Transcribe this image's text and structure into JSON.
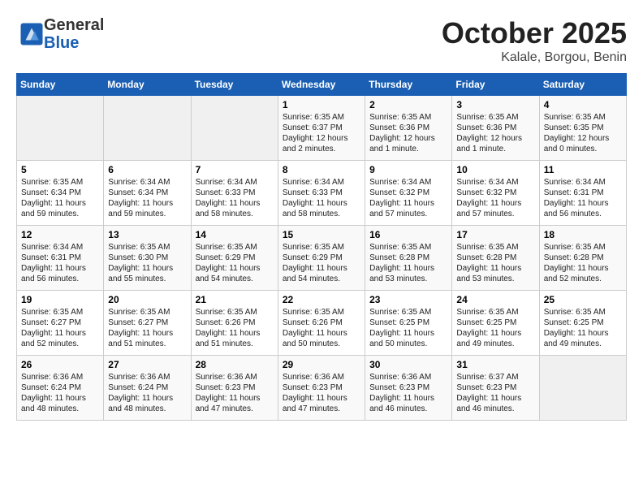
{
  "header": {
    "logo_general": "General",
    "logo_blue": "Blue",
    "month": "October 2025",
    "location": "Kalale, Borgou, Benin"
  },
  "weekdays": [
    "Sunday",
    "Monday",
    "Tuesday",
    "Wednesday",
    "Thursday",
    "Friday",
    "Saturday"
  ],
  "weeks": [
    [
      {
        "day": "",
        "info": ""
      },
      {
        "day": "",
        "info": ""
      },
      {
        "day": "",
        "info": ""
      },
      {
        "day": "1",
        "info": "Sunrise: 6:35 AM\nSunset: 6:37 PM\nDaylight: 12 hours\nand 2 minutes."
      },
      {
        "day": "2",
        "info": "Sunrise: 6:35 AM\nSunset: 6:36 PM\nDaylight: 12 hours\nand 1 minute."
      },
      {
        "day": "3",
        "info": "Sunrise: 6:35 AM\nSunset: 6:36 PM\nDaylight: 12 hours\nand 1 minute."
      },
      {
        "day": "4",
        "info": "Sunrise: 6:35 AM\nSunset: 6:35 PM\nDaylight: 12 hours\nand 0 minutes."
      }
    ],
    [
      {
        "day": "5",
        "info": "Sunrise: 6:35 AM\nSunset: 6:34 PM\nDaylight: 11 hours\nand 59 minutes."
      },
      {
        "day": "6",
        "info": "Sunrise: 6:34 AM\nSunset: 6:34 PM\nDaylight: 11 hours\nand 59 minutes."
      },
      {
        "day": "7",
        "info": "Sunrise: 6:34 AM\nSunset: 6:33 PM\nDaylight: 11 hours\nand 58 minutes."
      },
      {
        "day": "8",
        "info": "Sunrise: 6:34 AM\nSunset: 6:33 PM\nDaylight: 11 hours\nand 58 minutes."
      },
      {
        "day": "9",
        "info": "Sunrise: 6:34 AM\nSunset: 6:32 PM\nDaylight: 11 hours\nand 57 minutes."
      },
      {
        "day": "10",
        "info": "Sunrise: 6:34 AM\nSunset: 6:32 PM\nDaylight: 11 hours\nand 57 minutes."
      },
      {
        "day": "11",
        "info": "Sunrise: 6:34 AM\nSunset: 6:31 PM\nDaylight: 11 hours\nand 56 minutes."
      }
    ],
    [
      {
        "day": "12",
        "info": "Sunrise: 6:34 AM\nSunset: 6:31 PM\nDaylight: 11 hours\nand 56 minutes."
      },
      {
        "day": "13",
        "info": "Sunrise: 6:35 AM\nSunset: 6:30 PM\nDaylight: 11 hours\nand 55 minutes."
      },
      {
        "day": "14",
        "info": "Sunrise: 6:35 AM\nSunset: 6:29 PM\nDaylight: 11 hours\nand 54 minutes."
      },
      {
        "day": "15",
        "info": "Sunrise: 6:35 AM\nSunset: 6:29 PM\nDaylight: 11 hours\nand 54 minutes."
      },
      {
        "day": "16",
        "info": "Sunrise: 6:35 AM\nSunset: 6:28 PM\nDaylight: 11 hours\nand 53 minutes."
      },
      {
        "day": "17",
        "info": "Sunrise: 6:35 AM\nSunset: 6:28 PM\nDaylight: 11 hours\nand 53 minutes."
      },
      {
        "day": "18",
        "info": "Sunrise: 6:35 AM\nSunset: 6:28 PM\nDaylight: 11 hours\nand 52 minutes."
      }
    ],
    [
      {
        "day": "19",
        "info": "Sunrise: 6:35 AM\nSunset: 6:27 PM\nDaylight: 11 hours\nand 52 minutes."
      },
      {
        "day": "20",
        "info": "Sunrise: 6:35 AM\nSunset: 6:27 PM\nDaylight: 11 hours\nand 51 minutes."
      },
      {
        "day": "21",
        "info": "Sunrise: 6:35 AM\nSunset: 6:26 PM\nDaylight: 11 hours\nand 51 minutes."
      },
      {
        "day": "22",
        "info": "Sunrise: 6:35 AM\nSunset: 6:26 PM\nDaylight: 11 hours\nand 50 minutes."
      },
      {
        "day": "23",
        "info": "Sunrise: 6:35 AM\nSunset: 6:25 PM\nDaylight: 11 hours\nand 50 minutes."
      },
      {
        "day": "24",
        "info": "Sunrise: 6:35 AM\nSunset: 6:25 PM\nDaylight: 11 hours\nand 49 minutes."
      },
      {
        "day": "25",
        "info": "Sunrise: 6:35 AM\nSunset: 6:25 PM\nDaylight: 11 hours\nand 49 minutes."
      }
    ],
    [
      {
        "day": "26",
        "info": "Sunrise: 6:36 AM\nSunset: 6:24 PM\nDaylight: 11 hours\nand 48 minutes."
      },
      {
        "day": "27",
        "info": "Sunrise: 6:36 AM\nSunset: 6:24 PM\nDaylight: 11 hours\nand 48 minutes."
      },
      {
        "day": "28",
        "info": "Sunrise: 6:36 AM\nSunset: 6:23 PM\nDaylight: 11 hours\nand 47 minutes."
      },
      {
        "day": "29",
        "info": "Sunrise: 6:36 AM\nSunset: 6:23 PM\nDaylight: 11 hours\nand 47 minutes."
      },
      {
        "day": "30",
        "info": "Sunrise: 6:36 AM\nSunset: 6:23 PM\nDaylight: 11 hours\nand 46 minutes."
      },
      {
        "day": "31",
        "info": "Sunrise: 6:37 AM\nSunset: 6:23 PM\nDaylight: 11 hours\nand 46 minutes."
      },
      {
        "day": "",
        "info": ""
      }
    ]
  ]
}
